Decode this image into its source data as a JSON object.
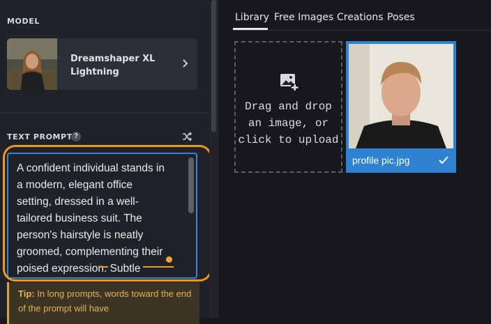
{
  "model": {
    "section_label": "MODEL",
    "name": "Dreamshaper XL Lightning",
    "thumbnail_icon": "model-thumbnail-portrait",
    "chevron_icon": "chevron-right-icon"
  },
  "prompt": {
    "section_label": "TEXT PROMPT",
    "help_icon": "question-icon",
    "help_glyph": "?",
    "shuffle_icon": "shuffle-icon",
    "text": "A confident individual stands in\na modern, elegant office\nsetting, dressed in a well-\ntailored business suit. The\nperson's hairstyle is neatly\ngroomed, complementing their\npoised expression. Subtle\naccessories like a stylish watch\nor sleek glasses add to the"
  },
  "tip": {
    "label": "Tip:",
    "text": " In long prompts, words toward the end of the prompt will have"
  },
  "tabs": [
    {
      "label": "Library",
      "active": true
    },
    {
      "label": "Free Images",
      "active": false
    },
    {
      "label": "Creations",
      "active": false
    },
    {
      "label": "Poses",
      "active": false
    }
  ],
  "upload": {
    "icon": "image-add-icon",
    "text": "Drag and drop\nan image, or\nclick to upload"
  },
  "library_items": [
    {
      "name": "profile pic.jpg",
      "selected": true,
      "icon": "check-icon"
    }
  ],
  "colors": {
    "accent_blue": "#2e82cf",
    "highlight_orange": "#f19a1a",
    "tip_text": "#e3b257"
  }
}
